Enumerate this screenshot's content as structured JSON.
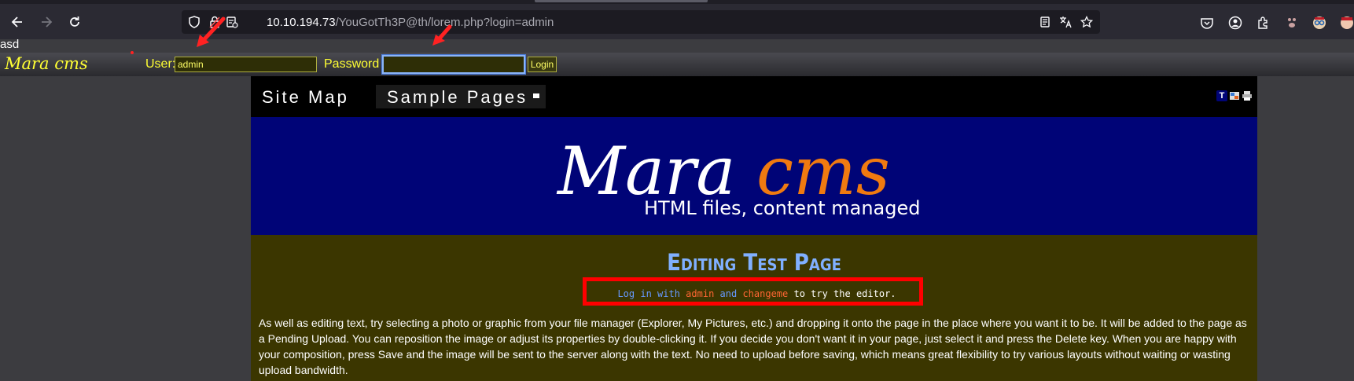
{
  "browser": {
    "url_host": "10.10.194.73",
    "url_path": "/YouGotTh3P@th/lorem.php?login=admin",
    "icons": [
      "back-arrow-icon",
      "forward-arrow-icon",
      "reload-icon",
      "shield-icon",
      "lock-icon",
      "page-info-icon",
      "reader-icon",
      "translate-icon",
      "bookmark-star-icon",
      "pocket-icon",
      "account-icon",
      "extensions-icon"
    ]
  },
  "page": {
    "stray_text": "asd",
    "login": {
      "brand": "Mara cms",
      "user_label": "User:",
      "user_value": "admin",
      "password_label": "Password",
      "password_value": "",
      "button_label": "Login"
    },
    "menu": {
      "items": [
        "Site Map",
        "Sample Pages"
      ],
      "tool_icons": [
        "text-icon",
        "image-icon",
        "print-icon"
      ]
    },
    "banner": {
      "logo_white": "Mara",
      "logo_orange": "cms",
      "tagline": "HTML files, content managed"
    },
    "content": {
      "title": "Editing Test Page",
      "hint": {
        "part1": "Log in with",
        "user": "admin",
        "part2": "and",
        "pass": "changeme",
        "part3": "to try the editor."
      },
      "paragraph": "As well as editing text, try selecting a photo or graphic from your file manager (Explorer, My Pictures, etc.) and dropping it onto the page in the place where you want it to be.  It will be added to the page as a Pending Upload. You can reposition the image or adjust its properties by double-clicking it. If you decide you don't want it in your page, just select it and press the Delete key.  When you are happy with your composition, press Save and the image will be sent to the server along with the text. No need to upload before saving, which means great flexibility to try various layouts without waiting or wasting upload bandwidth."
    }
  },
  "colors": {
    "accent_yellow": "#ffff33",
    "banner_blue": "#000477",
    "content_olive": "#3b3600",
    "annotation_red": "#ff0000",
    "logo_orange": "#f07a10"
  }
}
